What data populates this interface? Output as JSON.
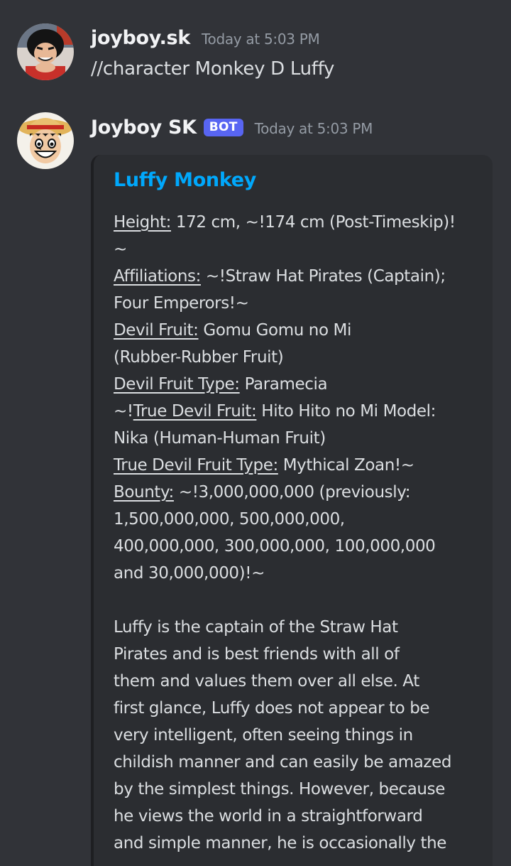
{
  "messages": [
    {
      "username": "joyboy.sk",
      "timestamp": "Today at 5:03 PM",
      "content": "//character Monkey D Luffy",
      "avatar_icon": "user-avatar-luffy"
    },
    {
      "username": "Joyboy SK",
      "badge": "BOT",
      "timestamp": "Today at 5:03 PM",
      "avatar_icon": "bot-avatar-luffy-straw-hat"
    }
  ],
  "embed": {
    "title": "Luffy Monkey",
    "accent_color": "#00a8fc",
    "height_label": "Height:",
    "height_value": " 172 cm, ~!174 cm (Post-Timeskip)!",
    "height_tail": "~",
    "affiliations_label": "Affiliations:",
    "affiliations_value": " ~!Straw Hat Pirates (Captain);",
    "affiliations_tail": "Four Emperors!~",
    "devil_fruit_label": "Devil Fruit:",
    "devil_fruit_value": " Gomu Gomu no Mi",
    "devil_fruit_tail": "(Rubber-Rubber Fruit)",
    "devil_fruit_type_label": "Devil Fruit Type:",
    "devil_fruit_type_value": " Paramecia",
    "true_devil_fruit_prefix": "~!",
    "true_devil_fruit_label": "True Devil Fruit:",
    "true_devil_fruit_value": " Hito Hito no Mi Model:",
    "true_devil_fruit_tail": "Nika (Human-Human Fruit)",
    "true_devil_fruit_type_label": "True Devil Fruit Type:",
    "true_devil_fruit_type_value": " Mythical Zoan!~",
    "bounty_label": "Bounty:",
    "bounty_value": " ~!3,000,000,000 (previously:",
    "bounty_line2": "1,500,000,000, 500,000,000,",
    "bounty_line3": "400,000,000, 300,000,000, 100,000,000",
    "bounty_line4": "and 30,000,000)!~",
    "description_lines": [
      "Luffy is the captain of the Straw Hat",
      "Pirates and is best friends with all of",
      "them and values them over all else. At",
      "first glance, Luffy does not appear to be",
      "very intelligent, often seeing things in",
      "childish manner and can easily be amazed",
      "by the simplest things. However, because",
      "he views the world in a straightforward",
      "and simple manner, he is occasionally the"
    ]
  }
}
